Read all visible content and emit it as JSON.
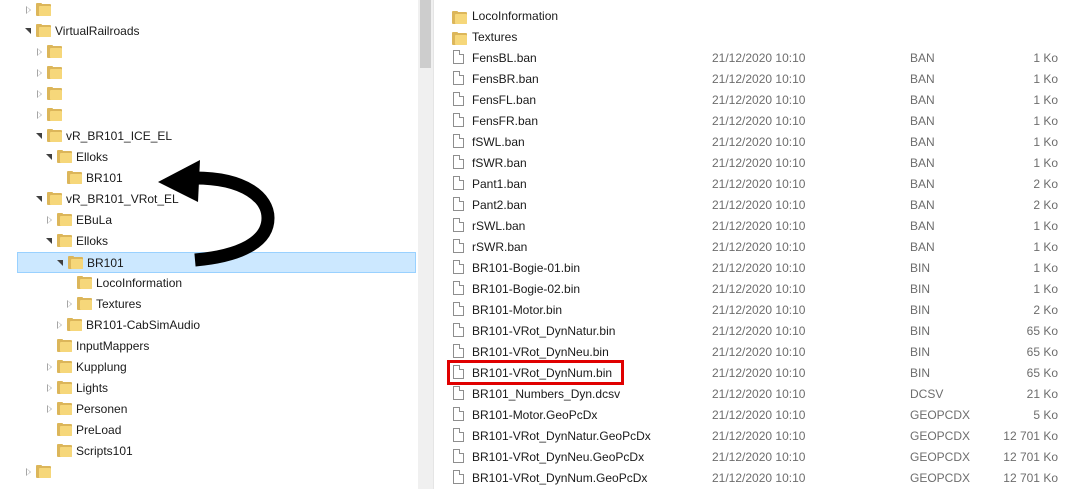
{
  "tree": {
    "rows": [
      {
        "label": "",
        "indent": 0,
        "state": "collapsed"
      },
      {
        "label": "VirtualRailroads",
        "indent": 0,
        "state": "expanded"
      },
      {
        "label": "",
        "indent": 1,
        "state": "collapsed"
      },
      {
        "label": "",
        "indent": 1,
        "state": "collapsed"
      },
      {
        "label": "",
        "indent": 1,
        "state": "collapsed"
      },
      {
        "label": "",
        "indent": 1,
        "state": "collapsed"
      },
      {
        "label": "vR_BR101_ICE_EL",
        "indent": 1,
        "state": "expanded"
      },
      {
        "label": "Elloks",
        "indent": 2,
        "state": "expanded"
      },
      {
        "label": "BR101",
        "indent": 3,
        "state": "none"
      },
      {
        "label": "vR_BR101_VRot_EL",
        "indent": 1,
        "state": "expanded"
      },
      {
        "label": "EBuLa",
        "indent": 2,
        "state": "collapsed"
      },
      {
        "label": "Elloks",
        "indent": 2,
        "state": "expanded"
      },
      {
        "label": "BR101",
        "indent": 3,
        "state": "expanded",
        "selected": true
      },
      {
        "label": "LocoInformation",
        "indent": 4,
        "state": "none"
      },
      {
        "label": "Textures",
        "indent": 4,
        "state": "collapsed"
      },
      {
        "label": "BR101-CabSimAudio",
        "indent": 3,
        "state": "collapsed"
      },
      {
        "label": "InputMappers",
        "indent": 2,
        "state": "none"
      },
      {
        "label": "Kupplung",
        "indent": 2,
        "state": "collapsed"
      },
      {
        "label": "Lights",
        "indent": 2,
        "state": "collapsed"
      },
      {
        "label": "Personen",
        "indent": 2,
        "state": "collapsed"
      },
      {
        "label": "PreLoad",
        "indent": 2,
        "state": "none"
      },
      {
        "label": "Scripts101",
        "indent": 2,
        "state": "none"
      },
      {
        "label": "",
        "indent": 0,
        "state": "collapsed"
      }
    ]
  },
  "files": [
    {
      "name": "LocoInformation",
      "date": "",
      "type": "",
      "size": "",
      "kind": "folder"
    },
    {
      "name": "Textures",
      "date": "",
      "type": "",
      "size": "",
      "kind": "folder"
    },
    {
      "name": "FensBL.ban",
      "date": "21/12/2020 10:10",
      "type": "BAN",
      "size": "1 Ko",
      "kind": "file"
    },
    {
      "name": "FensBR.ban",
      "date": "21/12/2020 10:10",
      "type": "BAN",
      "size": "1 Ko",
      "kind": "file"
    },
    {
      "name": "FensFL.ban",
      "date": "21/12/2020 10:10",
      "type": "BAN",
      "size": "1 Ko",
      "kind": "file"
    },
    {
      "name": "FensFR.ban",
      "date": "21/12/2020 10:10",
      "type": "BAN",
      "size": "1 Ko",
      "kind": "file"
    },
    {
      "name": "fSWL.ban",
      "date": "21/12/2020 10:10",
      "type": "BAN",
      "size": "1 Ko",
      "kind": "file"
    },
    {
      "name": "fSWR.ban",
      "date": "21/12/2020 10:10",
      "type": "BAN",
      "size": "1 Ko",
      "kind": "file"
    },
    {
      "name": "Pant1.ban",
      "date": "21/12/2020 10:10",
      "type": "BAN",
      "size": "2 Ko",
      "kind": "file"
    },
    {
      "name": "Pant2.ban",
      "date": "21/12/2020 10:10",
      "type": "BAN",
      "size": "2 Ko",
      "kind": "file"
    },
    {
      "name": "rSWL.ban",
      "date": "21/12/2020 10:10",
      "type": "BAN",
      "size": "1 Ko",
      "kind": "file"
    },
    {
      "name": "rSWR.ban",
      "date": "21/12/2020 10:10",
      "type": "BAN",
      "size": "1 Ko",
      "kind": "file"
    },
    {
      "name": "BR101-Bogie-01.bin",
      "date": "21/12/2020 10:10",
      "type": "BIN",
      "size": "1 Ko",
      "kind": "file"
    },
    {
      "name": "BR101-Bogie-02.bin",
      "date": "21/12/2020 10:10",
      "type": "BIN",
      "size": "1 Ko",
      "kind": "file"
    },
    {
      "name": "BR101-Motor.bin",
      "date": "21/12/2020 10:10",
      "type": "BIN",
      "size": "2 Ko",
      "kind": "file"
    },
    {
      "name": "BR101-VRot_DynNatur.bin",
      "date": "21/12/2020 10:10",
      "type": "BIN",
      "size": "65 Ko",
      "kind": "file"
    },
    {
      "name": "BR101-VRot_DynNeu.bin",
      "date": "21/12/2020 10:10",
      "type": "BIN",
      "size": "65 Ko",
      "kind": "file"
    },
    {
      "name": "BR101-VRot_DynNum.bin",
      "date": "21/12/2020 10:10",
      "type": "BIN",
      "size": "65 Ko",
      "kind": "file"
    },
    {
      "name": "BR101_Numbers_Dyn.dcsv",
      "date": "21/12/2020 10:10",
      "type": "DCSV",
      "size": "21 Ko",
      "kind": "file"
    },
    {
      "name": "BR101-Motor.GeoPcDx",
      "date": "21/12/2020 10:10",
      "type": "GEOPCDX",
      "size": "5 Ko",
      "kind": "file"
    },
    {
      "name": "BR101-VRot_DynNatur.GeoPcDx",
      "date": "21/12/2020 10:10",
      "type": "GEOPCDX",
      "size": "12 701 Ko",
      "kind": "file"
    },
    {
      "name": "BR101-VRot_DynNeu.GeoPcDx",
      "date": "21/12/2020 10:10",
      "type": "GEOPCDX",
      "size": "12 701 Ko",
      "kind": "file"
    },
    {
      "name": "BR101-VRot_DynNum.GeoPcDx",
      "date": "21/12/2020 10:10",
      "type": "GEOPCDX",
      "size": "12 701 Ko",
      "kind": "file"
    }
  ],
  "annotation": {
    "highlight_color": "#e00000",
    "arrow_color": "#000000"
  },
  "colors": {
    "folder": "#f6d77a",
    "selection": "#cce8ff",
    "secondary_text": "#6d6d6d"
  }
}
